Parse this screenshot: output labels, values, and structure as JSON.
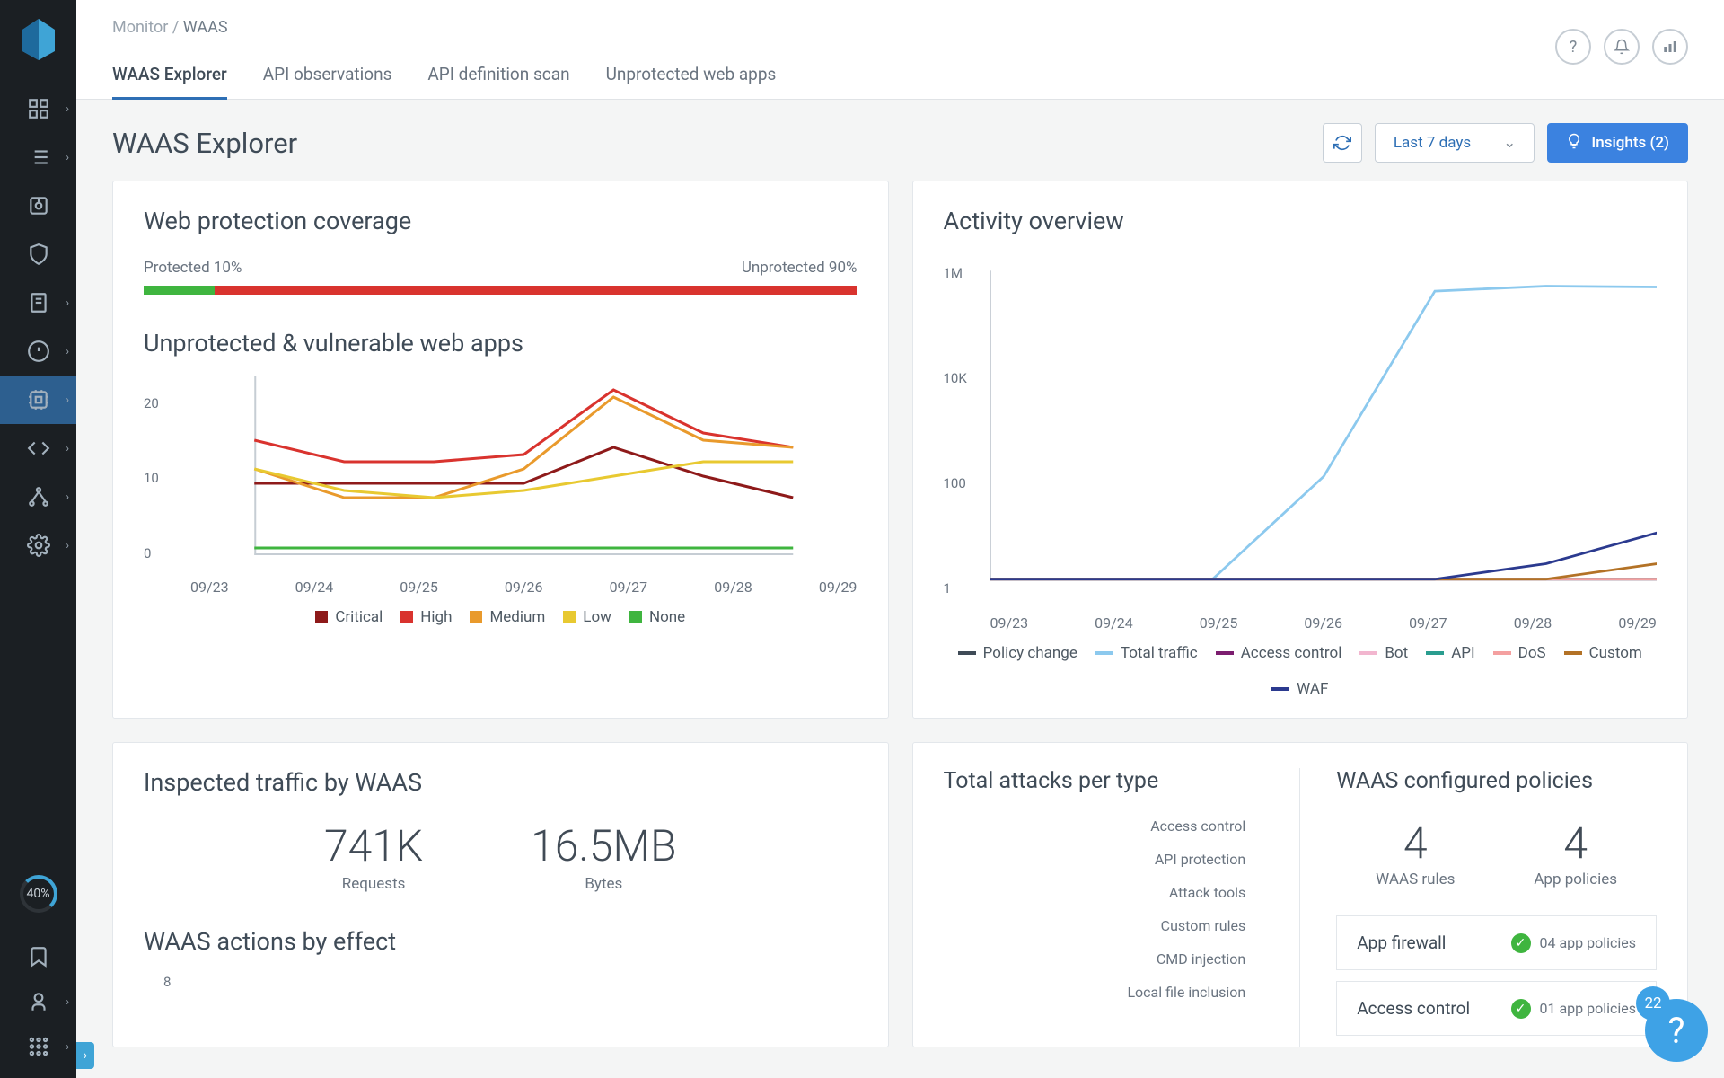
{
  "sidebar": {
    "progress_label": "40%",
    "icons": [
      {
        "name": "dashboard-icon",
        "caret": true
      },
      {
        "name": "list-icon",
        "caret": true
      },
      {
        "name": "radar-icon",
        "caret": false
      },
      {
        "name": "shield-icon",
        "caret": false
      },
      {
        "name": "compliance-icon",
        "caret": true
      },
      {
        "name": "alert-icon",
        "caret": true
      },
      {
        "name": "runtime-icon",
        "caret": true,
        "active": true
      },
      {
        "name": "code-icon",
        "caret": true
      },
      {
        "name": "network-icon",
        "caret": true
      },
      {
        "name": "gear-icon",
        "caret": true
      }
    ],
    "bottom_icons": [
      {
        "name": "bookmark-icon"
      },
      {
        "name": "user-icon",
        "caret": true
      },
      {
        "name": "apps-icon",
        "caret": true
      }
    ]
  },
  "breadcrumb": {
    "parent": "Monitor",
    "current": "WAAS"
  },
  "tabs": [
    {
      "label": "WAAS Explorer",
      "active": true
    },
    {
      "label": "API observations"
    },
    {
      "label": "API definition scan"
    },
    {
      "label": "Unprotected web apps"
    }
  ],
  "page_title": "WAAS Explorer",
  "title_actions": {
    "range_label": "Last 7 days",
    "insights_label": "Insights (2)"
  },
  "coverage": {
    "title": "Web protection coverage",
    "protected_label": "Protected 10%",
    "unprotected_label": "Unprotected 90%",
    "protected_pct": 10
  },
  "vuln": {
    "title": "Unprotected & vulnerable web apps",
    "legend": [
      {
        "label": "Critical",
        "color": "#8e1a1a"
      },
      {
        "label": "High",
        "color": "#d9332e"
      },
      {
        "label": "Medium",
        "color": "#e99a2c"
      },
      {
        "label": "Low",
        "color": "#e8c931"
      },
      {
        "label": "None",
        "color": "#3fb53f"
      }
    ],
    "x": [
      "09/23",
      "09/24",
      "09/25",
      "09/26",
      "09/27",
      "09/28",
      "09/29"
    ],
    "y_ticks": [
      "20",
      "10",
      "0"
    ]
  },
  "chart_data": {
    "vulnerable_apps": {
      "type": "line",
      "x": [
        "09/23",
        "09/24",
        "09/25",
        "09/26",
        "09/27",
        "09/28",
        "09/29"
      ],
      "series": [
        {
          "name": "Critical",
          "color": "#8e1a1a",
          "values": [
            10,
            10,
            10,
            10,
            15,
            11,
            8
          ]
        },
        {
          "name": "High",
          "color": "#d9332e",
          "values": [
            16,
            13,
            13,
            14,
            23,
            17,
            15
          ]
        },
        {
          "name": "Medium",
          "color": "#e99a2c",
          "values": [
            12,
            8,
            8,
            12,
            22,
            16,
            15
          ]
        },
        {
          "name": "Low",
          "color": "#e8c931",
          "values": [
            12,
            9,
            8,
            9,
            11,
            13,
            13
          ]
        },
        {
          "name": "None",
          "color": "#3fb53f",
          "values": [
            1,
            1,
            1,
            1,
            1,
            1,
            1
          ]
        }
      ],
      "ylim": [
        0,
        25
      ],
      "y_ticks": [
        0,
        10,
        20
      ]
    },
    "activity_overview": {
      "type": "line",
      "x": [
        "09/23",
        "09/24",
        "09/25",
        "09/26",
        "09/27",
        "09/28",
        "09/29"
      ],
      "series": [
        {
          "name": "Policy change",
          "color": "#3f4b57",
          "values": [
            1,
            1,
            1,
            1,
            1,
            1,
            1
          ]
        },
        {
          "name": "Total traffic",
          "color": "#8cc9ee",
          "values": [
            1,
            1,
            1,
            100,
            400000,
            500000,
            480000
          ]
        },
        {
          "name": "Access control",
          "color": "#7c1d6f",
          "values": [
            1,
            1,
            1,
            1,
            1,
            1,
            1
          ]
        },
        {
          "name": "Bot",
          "color": "#f2b6cf",
          "values": [
            1,
            1,
            1,
            1,
            1,
            1,
            1
          ]
        },
        {
          "name": "API",
          "color": "#2a9d8f",
          "values": [
            1,
            1,
            1,
            1,
            1,
            1,
            1
          ]
        },
        {
          "name": "DoS",
          "color": "#f4a0a0",
          "values": [
            1,
            1,
            1,
            1,
            1,
            1,
            1
          ]
        },
        {
          "name": "Custom",
          "color": "#b37226",
          "values": [
            1,
            1,
            1,
            1,
            1,
            1,
            2
          ]
        },
        {
          "name": "WAF",
          "color": "#2b3a8f",
          "values": [
            1,
            1,
            1,
            1,
            1,
            2,
            8
          ]
        }
      ],
      "y_ticks": [
        "1",
        "100",
        "10K",
        "1M"
      ],
      "log_scale": true
    },
    "traffic": {
      "requests": "741K",
      "requests_label": "Requests",
      "bytes": "16.5MB",
      "bytes_label": "Bytes"
    },
    "actions_by_effect": {
      "type": "bar",
      "y_ticks": [
        "8"
      ]
    },
    "attacks_per_type": {
      "type": "bar",
      "categories": [
        "Access control",
        "API protection",
        "Attack tools",
        "Custom rules",
        "CMD injection",
        "Local file inclusion"
      ]
    },
    "policies": {
      "rules_count": "4",
      "rules_label": "WAAS rules",
      "apps_count": "4",
      "apps_label": "App policies",
      "rows": [
        {
          "name": "App firewall",
          "right": "04 app policies"
        },
        {
          "name": "Access control",
          "right": "01 app policies"
        }
      ]
    }
  },
  "activity": {
    "title": "Activity overview",
    "legend": [
      {
        "label": "Policy change",
        "color": "#3f4b57"
      },
      {
        "label": "Total traffic",
        "color": "#8cc9ee"
      },
      {
        "label": "Access control",
        "color": "#7c1d6f"
      },
      {
        "label": "Bot",
        "color": "#f2b6cf"
      },
      {
        "label": "API",
        "color": "#2a9d8f"
      },
      {
        "label": "DoS",
        "color": "#f4a0a0"
      },
      {
        "label": "Custom",
        "color": "#b37226"
      },
      {
        "label": "WAF",
        "color": "#2b3a8f"
      }
    ]
  },
  "traffic_card": {
    "title": "Inspected traffic by WAAS",
    "sub": "WAAS actions by effect"
  },
  "attacks_card": {
    "title": "Total attacks per type"
  },
  "policies_card": {
    "title": "WAAS configured policies"
  },
  "fab_badge": "22"
}
